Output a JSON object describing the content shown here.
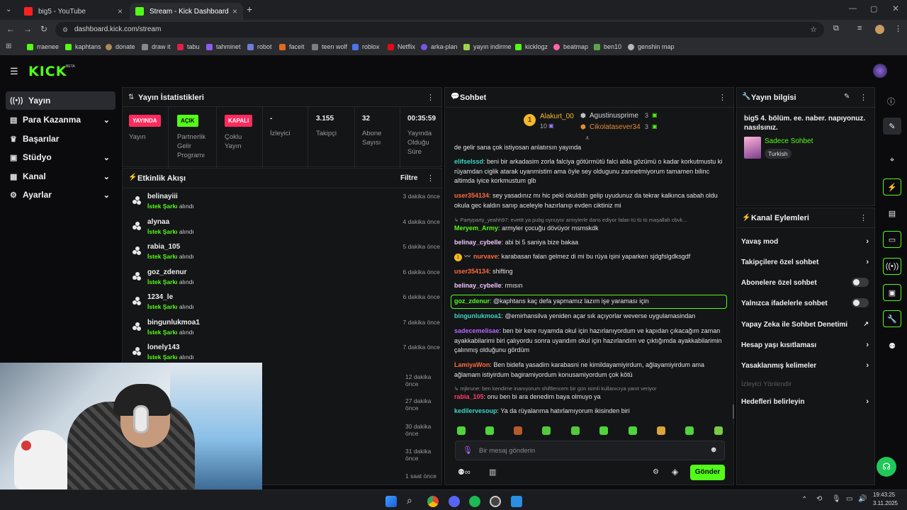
{
  "browser": {
    "tabs": [
      {
        "title": "big5 - YouTube"
      },
      {
        "title": "Stream - Kick Dashboard"
      }
    ],
    "url": "dashboard.kick.com/stream",
    "bookmarks": [
      "rraenee",
      "kaphtans",
      "donate",
      "draw it",
      "tabu",
      "tahminet",
      "robot",
      "faceit",
      "teen wolf",
      "roblox",
      "Netflix",
      "arka-plan",
      "yayın indirme",
      "kicklogz",
      "beatmap",
      "ben10",
      "genshin map"
    ]
  },
  "sidebar": {
    "items": [
      {
        "label": "Yayın"
      },
      {
        "label": "Para Kazanma"
      },
      {
        "label": "Başarılar"
      },
      {
        "label": "Stüdyo"
      },
      {
        "label": "Kanal"
      },
      {
        "label": "Ayarlar"
      }
    ]
  },
  "stats": {
    "title": "Yayın İstatistikleri",
    "badges": [
      {
        "badge": "YAYINDA",
        "label": "Yayın"
      },
      {
        "badge": "AÇIK",
        "label": "Partnerlik Gelir Programı"
      },
      {
        "badge": "KAPALI",
        "label": "Çoklu Yayın"
      }
    ],
    "viewers": {
      "value": "-",
      "label": "İzleyici"
    },
    "followers": {
      "value": "3.155",
      "label": "Takipçi"
    },
    "subs": {
      "value": "32",
      "label": "Abone Sayısı"
    },
    "uptime": {
      "value": "00:35:59",
      "label": "Yayında Olduğu Süre"
    }
  },
  "activity": {
    "title": "Etkinlik Akışı",
    "filter": "Filtre",
    "events": [
      {
        "user": "belinayiii",
        "what": "İstek Şarkı",
        "suffix": "alındı",
        "time": "3 dakika önce"
      },
      {
        "user": "alynaa",
        "what": "İstek Şarkı",
        "suffix": "alındı",
        "time": "4 dakika önce"
      },
      {
        "user": "rabia_105",
        "what": "İstek Şarkı",
        "suffix": "alındı",
        "time": "5 dakika önce"
      },
      {
        "user": "goz_zdenur",
        "what": "İstek Şarkı",
        "suffix": "alındı",
        "time": "6 dakika önce"
      },
      {
        "user": "1234_le",
        "what": "İstek Şarkı",
        "suffix": "alındı",
        "time": "6 dakika önce"
      },
      {
        "user": "bingunlukmoa1",
        "what": "İstek Şarkı",
        "suffix": "alındı",
        "time": "7 dakika önce"
      },
      {
        "user": "lonely143",
        "what": "İstek Şarkı",
        "suffix": "alındı",
        "time": "7 dakika önce"
      }
    ],
    "hidden_times": [
      "12 dakika önce",
      "27 dakika önce",
      "30 dakika önce",
      "31 dakika önce",
      "1 saat önce"
    ]
  },
  "chat": {
    "title": "Sohbet",
    "leaders": {
      "top": {
        "name": "Alakurt_00",
        "count": "10",
        "rank": "1"
      },
      "second": {
        "name": "Agustinusprime",
        "count": "3"
      },
      "third": {
        "name": "Cikolatasever34",
        "count": "3"
      }
    },
    "messages": [
      {
        "user": "",
        "text": "de gelir sana çok istiyosan anlatırsın yayında",
        "color": "#e4e4e4"
      },
      {
        "user": "elifselssd",
        "text": "beni bir arkadasim zorla falciya götürmütü falci abla gözümü o kadar korkutmustu ki rüyamdan ciglik atarak uyanmistim ama öyle sey oldugunu zannetmiyorum tamamen bilinc altimda iyice korkmustum glb",
        "color": "#3bd6c6"
      },
      {
        "user": "user354134",
        "text": "sey yasadınız mı hic peki okulddn gelip uyudunuz da tekrar kalkınca sabah oldu okula gec kaldın sanıp aceleyle hazırlanıp evden ciktiniz mi",
        "color": "#ff6b3d"
      },
      {
        "user": "",
        "text": "Partyparty_yeahh97: evettt ya pubg oynuyor armylerle dans ediyor falan tü tü tü maşallah cbvk...",
        "color": "#9a9a9a"
      },
      {
        "user": "Meryem_Army",
        "text": "armyler çocuğu dövüyor msmskdk",
        "color": "#53fc18"
      },
      {
        "user": "belinay_cybelle",
        "text": "abi bi 5 saniya bize bakaa",
        "color": "#f0c6ff"
      },
      {
        "user": "nurvave",
        "text": "karabasan falan gelmez di mi bu rüya işini yaparken sjdgfslgdksgdf",
        "color": "#ff6b3d"
      },
      {
        "user": "user354134",
        "text": "shifting",
        "color": "#ff6b3d"
      },
      {
        "user": "belinay_cybelle",
        "text": "rmısın",
        "color": "#f0c6ff"
      },
      {
        "user": "goz_zdenur",
        "text": "@kaphtans kaç defa yapmamız lazım işe yaraması için",
        "color": "#53fc18"
      },
      {
        "user": "bingunlukmoa1",
        "text": "@emirhansilva yeniden açar sık açıyorlar weverse uygulamasindan",
        "color": "#3bd6c6"
      },
      {
        "user": "sadecemelisae",
        "text": "ben bir kere ruyamda okul için hazırlanıyordum ve kapıdan çıkacağım zaman ayakkabilarimi biri çalıyordu sonra uyandım okul için hazırlandım ve çıktığımda ayakkabilarimin çalınmış olduğunu gördüm",
        "color": "#b266ff"
      },
      {
        "user": "LamiyaWon",
        "text": "Ben bidefa yasadim karabasni ne kimildayamiyirdum, ağlayamiyirdum ama ağlamam istiyirdum bagiramiyordum konusamiyordum çok kötü",
        "color": "#ff6b3d"
      },
      {
        "user": "",
        "text": "mjkrune: ben kendime inanıyorum shiftlencem bir gün isimli kullanıcıya yanıt veriyor",
        "color": "#9a9a9a"
      },
      {
        "user": "rabia_105",
        "text": "onu ben bi ara denedim baya olmuyo ya",
        "color": "#ff3d6b"
      },
      {
        "user": "kedilervesoup",
        "text": "Ya da rüyalarıma hatırlamıyorum ikisinden biri",
        "color": "#3bd6c6"
      }
    ],
    "input_placeholder": "Bir mesaj gönderin",
    "send_label": "Gönder"
  },
  "stream_info": {
    "title": "Yayın bilgisi",
    "stream_title": "big5 4. bölüm. ee. naber. napıyonuz. nasılsınız.",
    "category": "Sadece Sohbet",
    "language": "Turkish"
  },
  "channel_actions": {
    "title": "Kanal Eylemleri",
    "items": [
      {
        "label": "Yavaş mod",
        "control": "chevron"
      },
      {
        "label": "Takipçilere özel sohbet",
        "control": "chevron"
      },
      {
        "label": "Abonelere özel sohbet",
        "control": "toggle"
      },
      {
        "label": "Yalnızca ifadelerle sohbet",
        "control": "toggle"
      },
      {
        "label": "Yapay Zeka ile Sohbet Denetimi",
        "control": "external"
      },
      {
        "label": "Hesap yaşı kısıtlaması",
        "control": "chevron"
      },
      {
        "label": "Yasaklanmış kelimeler",
        "control": "chevron"
      },
      {
        "label": "İzleyici Yönlendir",
        "control": "disabled"
      },
      {
        "label": "Hedefleri belirleyin",
        "control": "chevron"
      }
    ]
  },
  "taskbar": {
    "time": "19:43:25",
    "date": "3.11.2025"
  },
  "colors": {
    "accent": "#53fc18",
    "live": "#ff2b5e",
    "panel": "#141517"
  }
}
